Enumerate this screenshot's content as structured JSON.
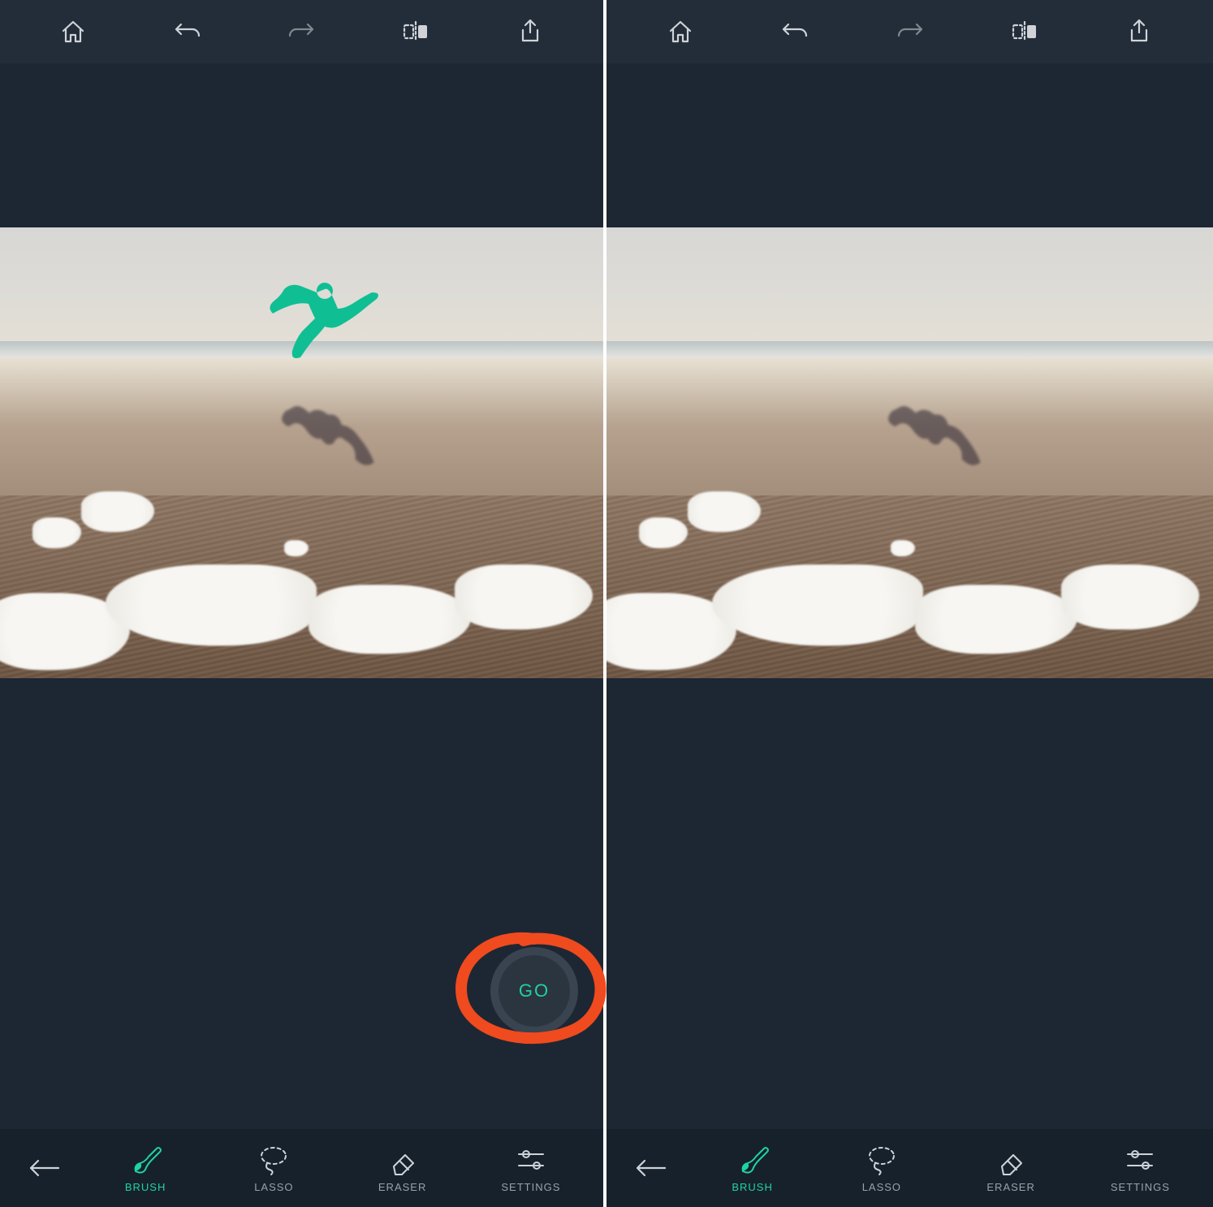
{
  "colors": {
    "accent": "#1fd3a3",
    "mask": "#0fbf93",
    "annotation": "#f04a1f",
    "toolbar_bg": "#232d39",
    "panel_bg": "#1d2733",
    "bottombar_bg": "#17212c",
    "icon": "#cfd3d8"
  },
  "top_toolbar": {
    "items": [
      {
        "name": "home-icon"
      },
      {
        "name": "undo-icon"
      },
      {
        "name": "redo-icon"
      },
      {
        "name": "compare-icon"
      },
      {
        "name": "share-icon"
      }
    ]
  },
  "action_button": {
    "label": "GO"
  },
  "bottom_toolbar": {
    "back": {
      "name": "back-icon"
    },
    "tools": [
      {
        "name": "brush",
        "label": "BRUSH",
        "active": true
      },
      {
        "name": "lasso",
        "label": "LASSO",
        "active": false
      },
      {
        "name": "eraser",
        "label": "ERASER",
        "active": false
      },
      {
        "name": "settings",
        "label": "SETTINGS",
        "active": false
      }
    ]
  },
  "panels": {
    "left": {
      "has_mask_overlay": true,
      "has_go_button": true
    },
    "right": {
      "has_mask_overlay": false,
      "has_go_button": false
    }
  }
}
